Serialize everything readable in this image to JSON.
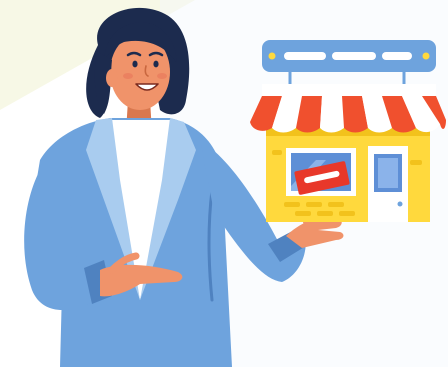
{
  "illustration": {
    "subject": "woman-presenting-storefront",
    "colors": {
      "background_corner": "#f7f8e6",
      "background_wash": "#f4f8fc",
      "blazer": "#6ea3dd",
      "blazer_shadow": "#4f82c0",
      "blazer_lapel": "#a9ccef",
      "shirt": "#ffffff",
      "skin": "#f0936a",
      "skin_shadow": "#d9784f",
      "hair": "#1c2b4e",
      "awning_red": "#f0502e",
      "awning_white": "#ffffff",
      "shop_wall": "#ffd93d",
      "shop_wall_shadow": "#f2c21c",
      "window_glass": "#5e8fd6",
      "window_frame": "#ffffff",
      "sign_red": "#e8382a",
      "signboard": "#6ea3dd",
      "sign_dot": "#ffd93d"
    },
    "icons": [
      "woman-figure",
      "store-icon",
      "awning-icon",
      "signboard-icon",
      "shop-window-icon",
      "shop-door-icon"
    ]
  }
}
